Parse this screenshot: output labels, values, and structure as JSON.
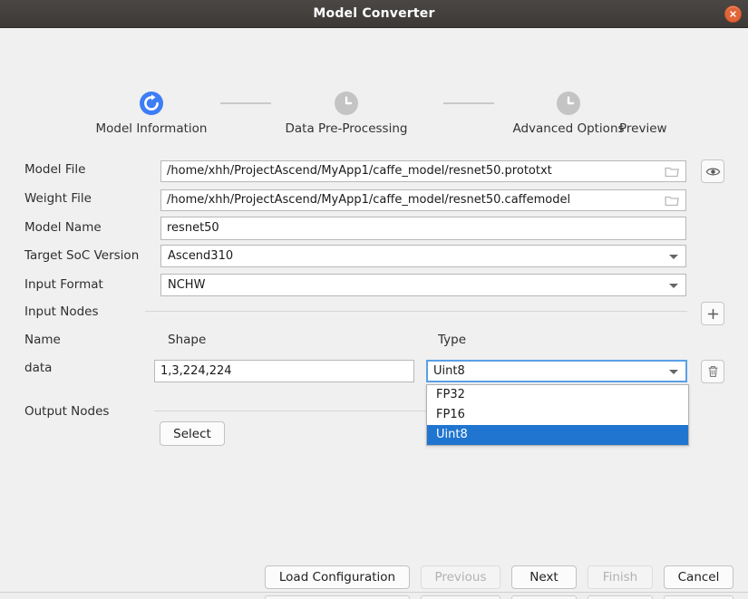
{
  "window": {
    "title": "Model Converter",
    "close_icon": "close-icon",
    "titlebar_color": "#3f3c39",
    "close_button_color": "#e2653a",
    "background_color": "#f0f0f0"
  },
  "stepper": {
    "accent_color": "#3d7df5",
    "pending_color": "#c4c4c4",
    "steps": [
      {
        "label": "Model Information",
        "icon": "refresh-circle-icon",
        "state": "active"
      },
      {
        "label": "Data Pre-Processing",
        "icon": "clock-icon",
        "state": "pending"
      },
      {
        "label": "Advanced Options",
        "icon": "clock-icon",
        "state": "pending"
      },
      {
        "label": "Preview",
        "icon": "clock-icon",
        "state": "pending"
      }
    ]
  },
  "form": {
    "model_file": {
      "label": "Model File",
      "value": "/home/xhh/ProjectAscend/MyApp1/caffe_model/resnet50.prototxt",
      "placeholder": "",
      "browse_icon": "folder-icon",
      "preview_icon": "eye-icon"
    },
    "weight_file": {
      "label": "Weight File",
      "value": "/home/xhh/ProjectAscend/MyApp1/caffe_model/resnet50.caffemodel",
      "placeholder": "",
      "browse_icon": "folder-icon"
    },
    "model_name": {
      "label": "Model Name",
      "value": "resnet50",
      "placeholder": ""
    },
    "target_soc": {
      "label": "Target SoC Version",
      "value": "Ascend310",
      "options": [
        "Ascend310"
      ]
    },
    "input_format": {
      "label": "Input Format",
      "value": "NCHW",
      "options": [
        "NCHW"
      ]
    },
    "input_nodes": {
      "label": "Input Nodes",
      "add_icon": "plus-icon",
      "delete_icon": "trash-icon",
      "columns": [
        "Name",
        "Shape",
        "Type"
      ],
      "rows": [
        {
          "name": "data",
          "shape": "1,3,224,224",
          "type": "Uint8"
        }
      ],
      "type_dropdown": {
        "open": true,
        "selected": "Uint8",
        "options": [
          "FP32",
          "FP16",
          "Uint8"
        ],
        "highlight_color": "#1f75cf"
      }
    },
    "output_nodes": {
      "label": "Output Nodes",
      "select_label": "Select"
    }
  },
  "footer": {
    "buttons": [
      {
        "label": "Load Configuration",
        "enabled": true
      },
      {
        "label": "Previous",
        "enabled": false
      },
      {
        "label": "Next",
        "enabled": true
      },
      {
        "label": "Finish",
        "enabled": false
      },
      {
        "label": "Cancel",
        "enabled": true
      }
    ]
  }
}
